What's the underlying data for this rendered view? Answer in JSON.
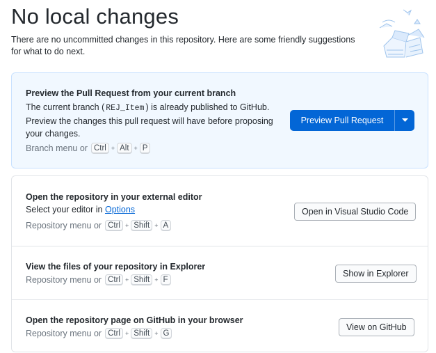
{
  "header": {
    "title": "No local changes",
    "subtitle": "There are no uncommitted changes in this repository. Here are some friendly suggestions for what to do next."
  },
  "preview": {
    "heading": "Preview the Pull Request from your current branch",
    "desc_pre": "The current branch (",
    "branch": "REJ_Item",
    "desc_post": ") is already published to GitHub.",
    "desc2": "Preview the changes this pull request will have before proposing your changes.",
    "menu_prefix": "Branch menu or",
    "keys": [
      "Ctrl",
      "Alt",
      "P"
    ],
    "button_label": "Preview Pull Request",
    "dropdown_icon": "caret-down-icon"
  },
  "editor": {
    "heading": "Open the repository in your external editor",
    "desc_pre": "Select your editor in",
    "link": "Options",
    "menu_prefix": "Repository menu or",
    "keys": [
      "Ctrl",
      "Shift",
      "A"
    ],
    "button_label": "Open in Visual Studio Code"
  },
  "explorer": {
    "heading": "View the files of your repository in Explorer",
    "menu_prefix": "Repository menu or",
    "keys": [
      "Ctrl",
      "Shift",
      "F"
    ],
    "button_label": "Show in Explorer"
  },
  "github": {
    "heading": "Open the repository page on GitHub in your browser",
    "menu_prefix": "Repository menu or",
    "keys": [
      "Ctrl",
      "Shift",
      "G"
    ],
    "button_label": "View on GitHub"
  },
  "colors": {
    "accent": "#0366d6",
    "card_bg": "#f1f8ff",
    "card_border": "#c8e1ff"
  }
}
